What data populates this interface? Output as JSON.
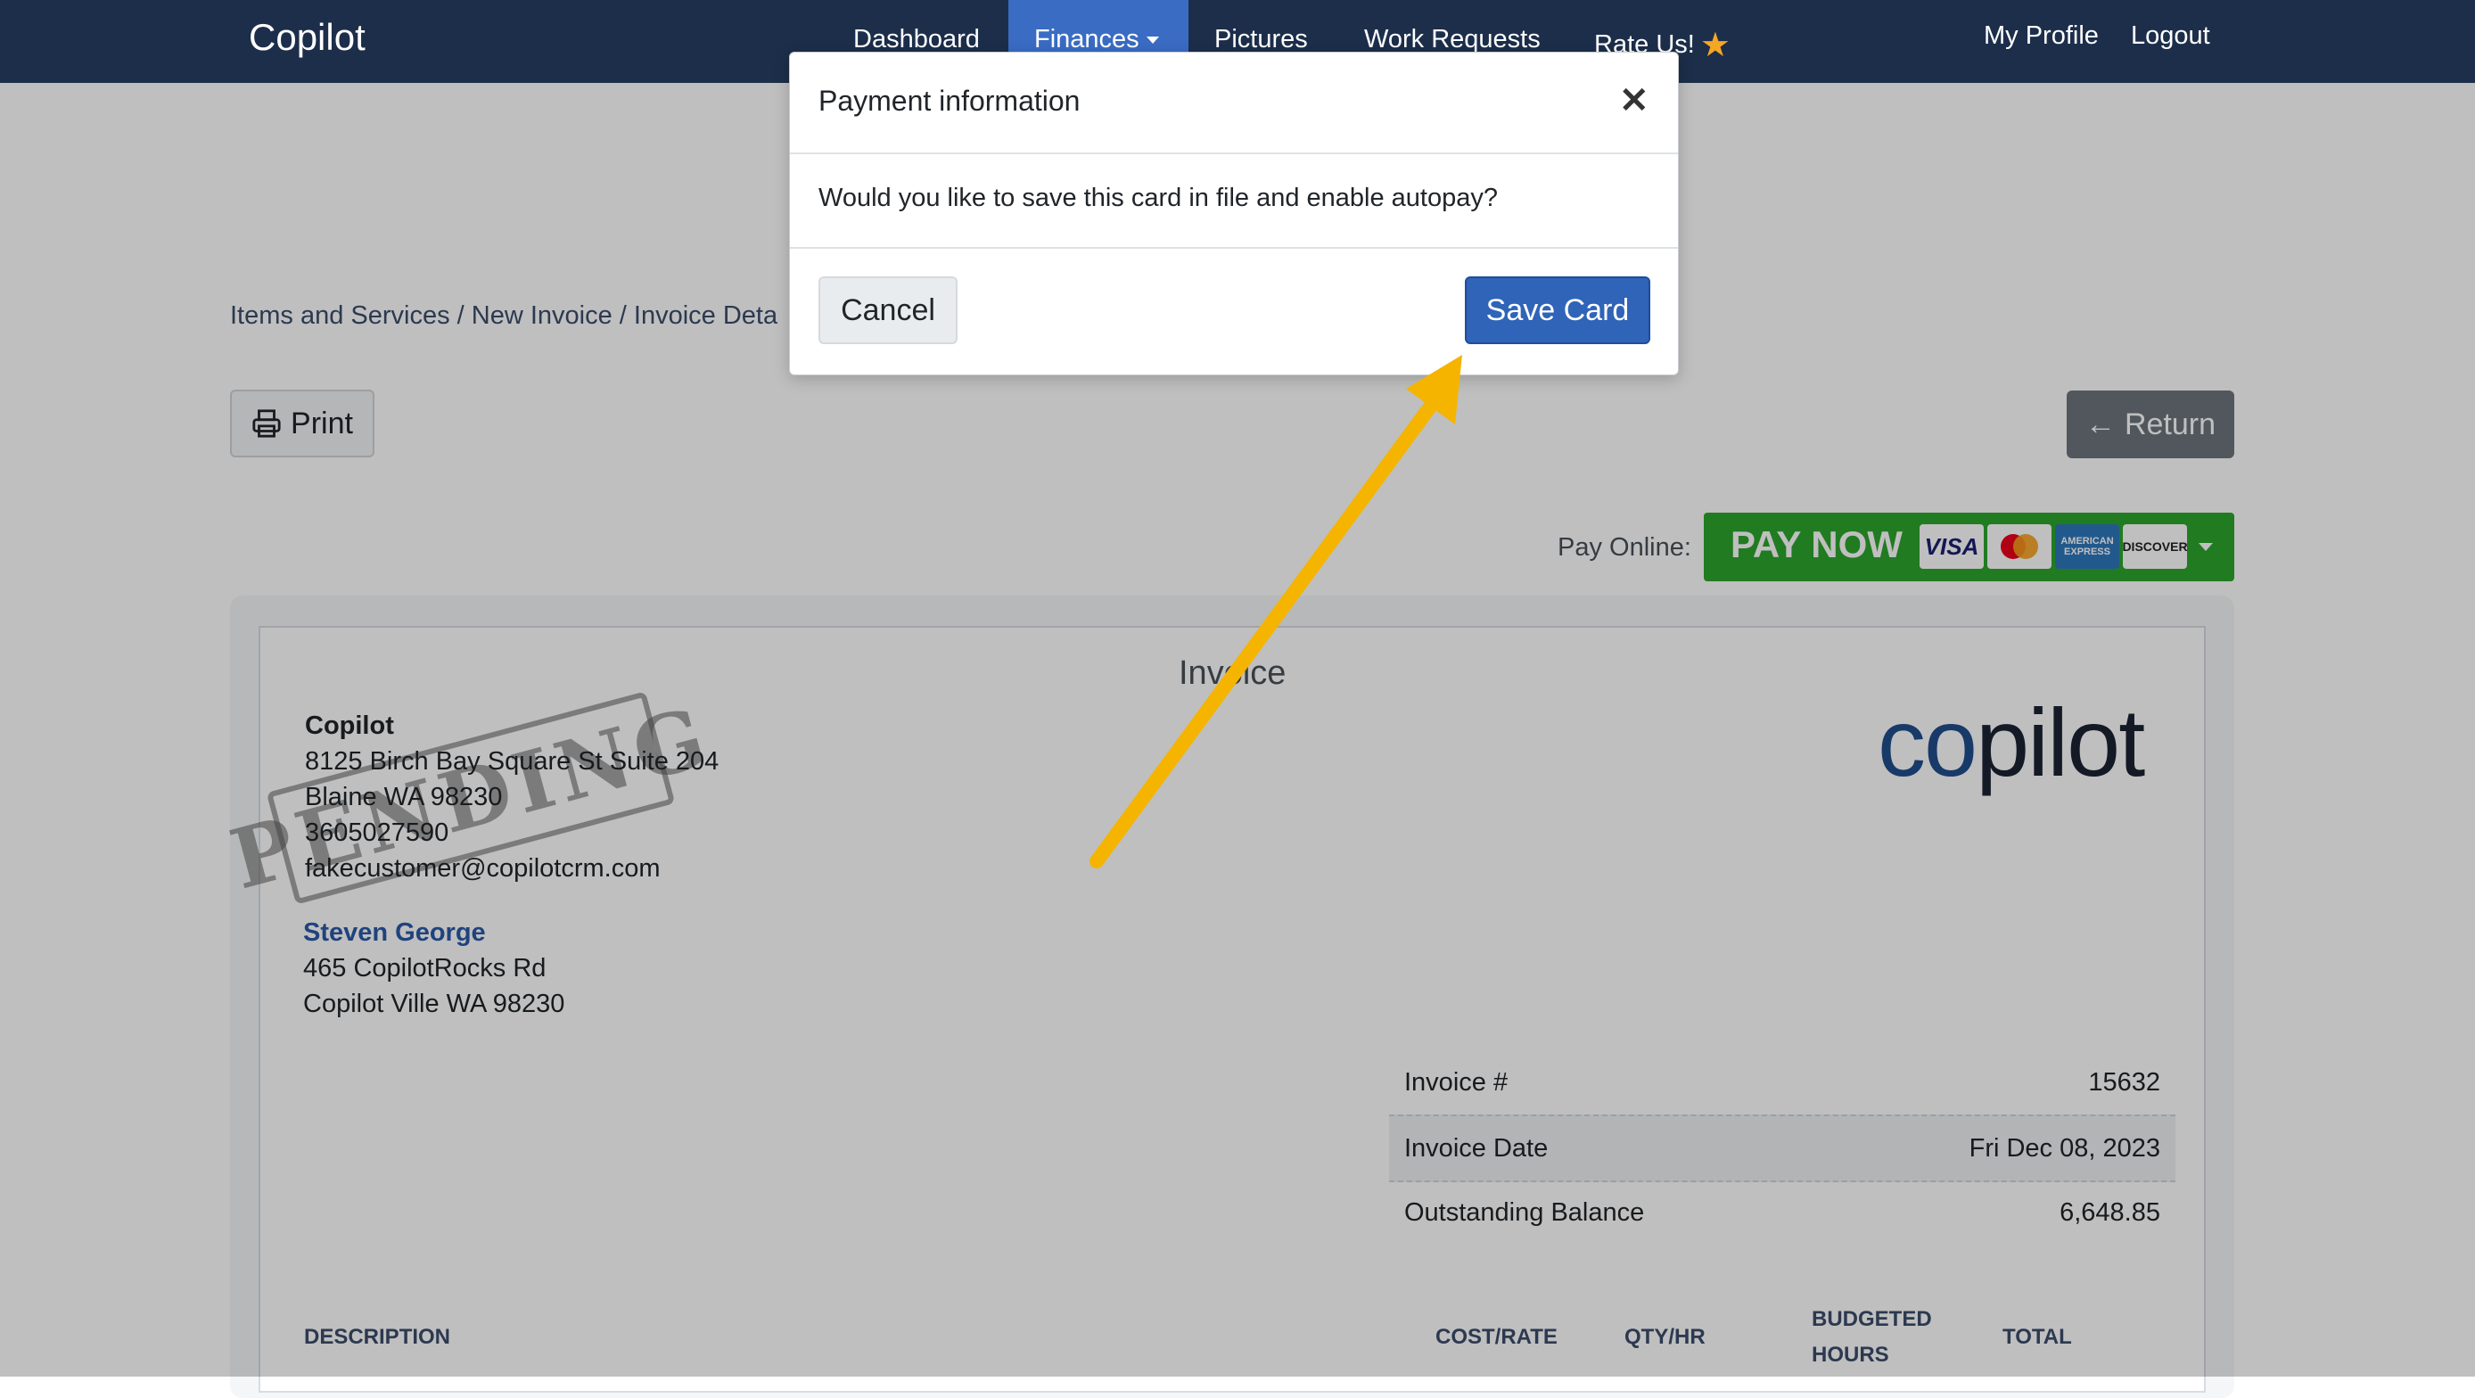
{
  "navbar": {
    "brand": "Copilot",
    "items": [
      {
        "label": "Dashboard"
      },
      {
        "label": "Finances"
      },
      {
        "label": "Pictures"
      },
      {
        "label": "Work Requests"
      },
      {
        "label": "Rate Us!"
      }
    ],
    "active_item": "Finances",
    "right_items": [
      {
        "label": "My Profile"
      },
      {
        "label": "Logout"
      }
    ]
  },
  "breadcrumb": "Items and Services / New Invoice / Invoice Deta",
  "toolbar": {
    "print_label": "Print",
    "return_label": "Return"
  },
  "pay_online": {
    "label": "Pay Online:",
    "button_label": "PAY NOW",
    "cards": [
      "VISA",
      "MasterCard",
      "AMERICAN EXPRESS",
      "DISCOVER"
    ],
    "button_color": "#2ca52c"
  },
  "invoice": {
    "title": "Invoice",
    "stamp_text": "PENDING",
    "company": {
      "name": "Copilot",
      "address": "8125 Birch Bay Square St Suite 204",
      "city_line": "Blaine WA 98230",
      "phone": "3605027590",
      "email": "fakecustomer@copilotcrm.com"
    },
    "customer": {
      "name": "Steven George",
      "address": "465 CopilotRocks Rd",
      "city_line": "Copilot Ville WA 98230"
    },
    "logo_text_a": "co",
    "logo_text_b": "pilot",
    "meta": [
      {
        "label": "Invoice #",
        "value": "15632"
      },
      {
        "label": "Invoice Date",
        "value": "Fri Dec 08, 2023"
      },
      {
        "label": "Outstanding Balance",
        "value": "6,648.85"
      }
    ],
    "table_headers": {
      "description": "DESCRIPTION",
      "cost": "COST/RATE",
      "qty": "QTY/HR",
      "budgeted_1": "BUDGETED",
      "budgeted_2": "HOURS",
      "total": "TOTAL"
    }
  },
  "modal": {
    "title": "Payment information",
    "body": "Would you like to save this card in file and enable autopay?",
    "cancel_label": "Cancel",
    "save_label": "Save Card",
    "close_icon": "close-icon"
  },
  "colors": {
    "navbar": "#1c2e4a",
    "nav_active": "#3a6cc4",
    "primary_button": "#2f64b8",
    "arrow": "#f5b400",
    "customer_link": "#2a5aa8"
  }
}
